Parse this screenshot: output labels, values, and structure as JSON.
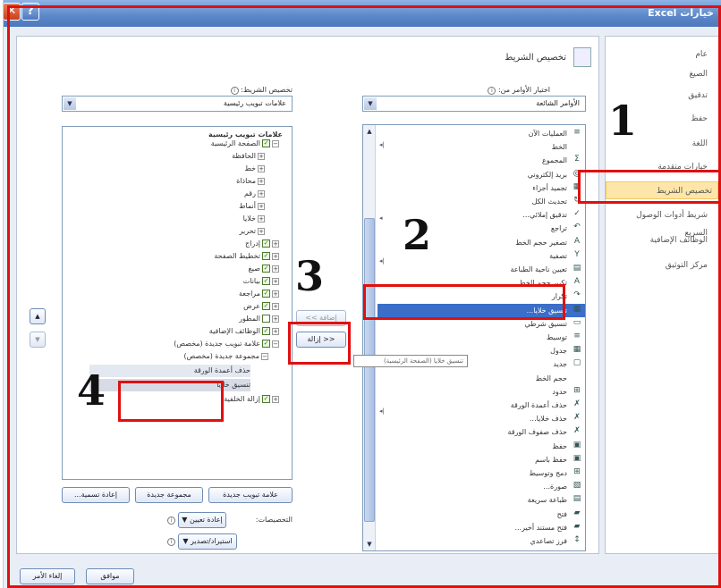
{
  "window": {
    "title": "خيارات Excel"
  },
  "nav": {
    "items": [
      {
        "label": "عام"
      },
      {
        "label": "الصيغ"
      },
      {
        "label": "تدقيق"
      },
      {
        "label": "حفظ"
      },
      {
        "label": "اللغة"
      },
      {
        "label": "خيارات متقدمة"
      },
      {
        "label": "تخصيص الشريط"
      },
      {
        "label": "شريط أدوات الوصول السريع"
      },
      {
        "label": "الوظائف الإضافية"
      },
      {
        "label": "مركز التوثيق"
      }
    ]
  },
  "section": {
    "title": "تخصيص الشريط"
  },
  "left_pane": {
    "choose_label": "اختيار الأوامر من:",
    "choose_value": "الأوامر الشائعة",
    "commands": [
      {
        "icon": "≡",
        "label": "العمليات الآن"
      },
      {
        "icon": "",
        "label": "الخط"
      },
      {
        "icon": "Σ",
        "label": "المجموع"
      },
      {
        "icon": "@",
        "label": "بريد إلكتروني"
      },
      {
        "icon": "▦",
        "label": "تجميد أجزاء"
      },
      {
        "icon": "↻",
        "label": "تحديث الكل"
      },
      {
        "icon": "✓",
        "label": "تدقيق إملائي..."
      },
      {
        "icon": "↶",
        "label": "تراجع"
      },
      {
        "icon": "A",
        "label": "تصغير حجم الخط"
      },
      {
        "icon": "Y",
        "label": "تصفية"
      },
      {
        "icon": "▤",
        "label": "تعيين ناحية الطباعة"
      },
      {
        "icon": "A",
        "label": "تكبير حجم الخط"
      },
      {
        "icon": "↷",
        "label": "تكرار"
      },
      {
        "icon": "▦",
        "label": "تنسيق خلايا..."
      },
      {
        "icon": "▭",
        "label": "تنسيق شرطي"
      },
      {
        "icon": "≡",
        "label": "توسيط"
      },
      {
        "icon": "▦",
        "label": "جدول"
      },
      {
        "icon": "▢",
        "label": "جديد"
      },
      {
        "icon": "",
        "label": "حجم الخط"
      },
      {
        "icon": "⊞",
        "label": "حدود"
      },
      {
        "icon": "✗",
        "label": "حذف أعمدة الورقة"
      },
      {
        "icon": "✗",
        "label": "حذف خلايا..."
      },
      {
        "icon": "✗",
        "label": "حذف صفوف الورقة"
      },
      {
        "icon": "▣",
        "label": "حفظ"
      },
      {
        "icon": "▣",
        "label": "حفظ باسم"
      },
      {
        "icon": "⊞",
        "label": "دمج وتوسيط"
      },
      {
        "icon": "▧",
        "label": "صورة..."
      },
      {
        "icon": "▤",
        "label": "طباعة سريعة"
      },
      {
        "icon": "▰",
        "label": "فتح"
      },
      {
        "icon": "▰",
        "label": "فتح مستند أخير..."
      },
      {
        "icon": "↕",
        "label": "فرز تصاعدي"
      }
    ],
    "tooltip": "تنسيق خلايا (الصفحة الرئيسية)"
  },
  "middle": {
    "add_button": "إضافة >>",
    "remove_button": "<< إزالة"
  },
  "right_pane": {
    "customize_label": "تخصيص الشريط:",
    "customize_value": "علامات تبويب رئيسية",
    "tree_header": "علامات تبويب رئيسية",
    "tree": [
      {
        "label": "الصفحة الرئيسية",
        "checked": true,
        "expander": "−"
      },
      {
        "label": "الحافظة",
        "checked": null,
        "expander": "+"
      },
      {
        "label": "خط",
        "checked": null,
        "expander": "+"
      },
      {
        "label": "محاذاة",
        "checked": null,
        "expander": "+"
      },
      {
        "label": "رقم",
        "checked": null,
        "expander": "+"
      },
      {
        "label": "أنماط",
        "checked": null,
        "expander": "+"
      },
      {
        "label": "خلايا",
        "checked": null,
        "expander": "+"
      },
      {
        "label": "تحرير",
        "checked": null,
        "expander": "+"
      },
      {
        "label": "إدراج",
        "checked": true,
        "expander": "+"
      },
      {
        "label": "تخطيط الصفحة",
        "checked": true,
        "expander": "+"
      },
      {
        "label": "صيغ",
        "checked": true,
        "expander": "+"
      },
      {
        "label": "بيانات",
        "checked": true,
        "expander": "+"
      },
      {
        "label": "مراجعة",
        "checked": true,
        "expander": "+"
      },
      {
        "label": "عرض",
        "checked": true,
        "expander": "+"
      },
      {
        "label": "المطور",
        "checked": false,
        "expander": "+"
      },
      {
        "label": "الوظائف الإضافية",
        "checked": true,
        "expander": "+"
      },
      {
        "label": "علامة تبويب جديدة (مخصص)",
        "checked": true,
        "expander": "−"
      },
      {
        "label": "مجموعة جديدة (مخصص)",
        "checked": null,
        "expander": "−"
      },
      {
        "label": "حذف أعمدة الورقة",
        "checked": null,
        "expander": ""
      },
      {
        "label": "تنسيق خلايا",
        "checked": null,
        "expander": ""
      },
      {
        "label": "إزالة الخلفية",
        "checked": true,
        "expander": "+"
      }
    ],
    "new_tab_button": "علامة تبويب جديدة",
    "new_group_button": "مجموعة جديدة",
    "rename_button": "إعادة تسمية...",
    "customizations_label": "التخصيصات:",
    "reset_button": "إعادة تعيين ▼",
    "import_export_button": "استيراد/تصدير ▼",
    "up_arrow": "▲",
    "down_arrow": "▼"
  },
  "footer": {
    "ok_button": "موافق",
    "cancel_button": "إلغاء الأمر"
  },
  "annotations": {
    "n1": "1",
    "n2": "2",
    "n3": "3",
    "n4": "4"
  }
}
